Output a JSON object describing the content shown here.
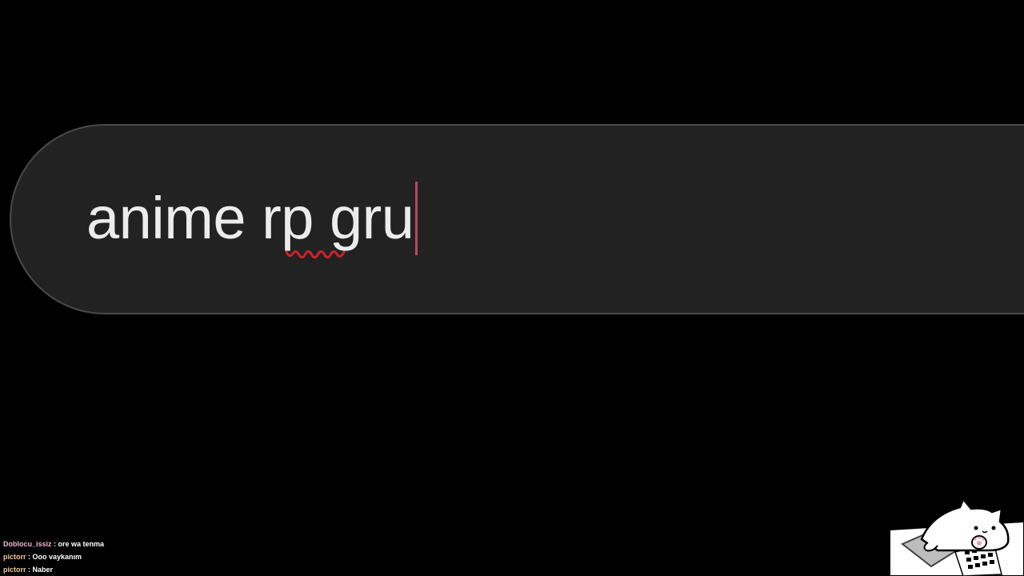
{
  "search": {
    "query": "anime rp gru",
    "misspelled_word": "rp"
  },
  "chat": {
    "messages": [
      {
        "user": "Doblocu_issiz",
        "separator": " : ",
        "text": "ore wa tenma",
        "user_color": "#f0b8d8"
      },
      {
        "user": "pictorr",
        "separator": " : ",
        "text": "Ooo vaykanım",
        "user_color": "#f2c79a"
      },
      {
        "user": "pictorr",
        "separator": " : ",
        "text": "Naber",
        "user_color": "#f2c79a"
      }
    ]
  },
  "colors": {
    "background": "#000000",
    "search_box": "#222222",
    "search_border": "#4a4a4a",
    "caret": "#b5495b",
    "spellcheck": "#d0202a"
  },
  "overlay": {
    "mascot_icon": "bongo-cat-icon"
  }
}
